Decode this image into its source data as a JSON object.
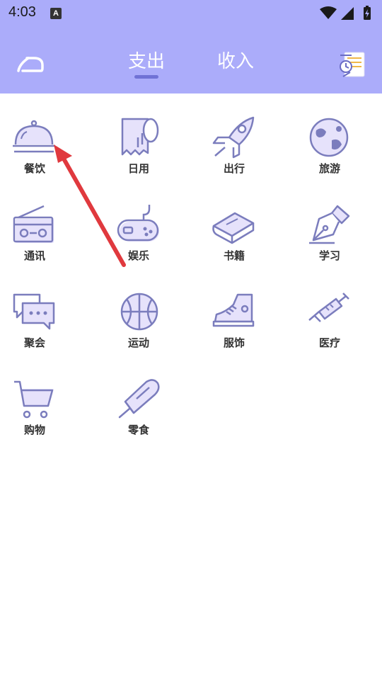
{
  "status_bar": {
    "time": "4:03",
    "app_icon_letter": "A"
  },
  "header": {
    "tabs": [
      {
        "label": "支出",
        "active": true
      },
      {
        "label": "收入",
        "active": false
      }
    ],
    "background": "#abacfa"
  },
  "categories": [
    {
      "label": "餐饮",
      "icon": "food-cloche-icon"
    },
    {
      "label": "日用",
      "icon": "toilet-paper-icon"
    },
    {
      "label": "出行",
      "icon": "rocket-icon"
    },
    {
      "label": "旅游",
      "icon": "globe-icon"
    },
    {
      "label": "通讯",
      "icon": "radio-icon"
    },
    {
      "label": "娱乐",
      "icon": "gamepad-icon"
    },
    {
      "label": "书籍",
      "icon": "book-icon"
    },
    {
      "label": "学习",
      "icon": "fountain-pen-icon"
    },
    {
      "label": "聚会",
      "icon": "chat-bubbles-icon"
    },
    {
      "label": "运动",
      "icon": "basketball-icon"
    },
    {
      "label": "服饰",
      "icon": "sneaker-icon"
    },
    {
      "label": "医疗",
      "icon": "syringe-icon"
    },
    {
      "label": "购物",
      "icon": "shopping-cart-icon"
    },
    {
      "label": "零食",
      "icon": "popsicle-icon"
    }
  ],
  "colors": {
    "icon_stroke": "#7b7dbd",
    "icon_fill": "#e6e2fb",
    "annotation_arrow": "#e0393e"
  }
}
